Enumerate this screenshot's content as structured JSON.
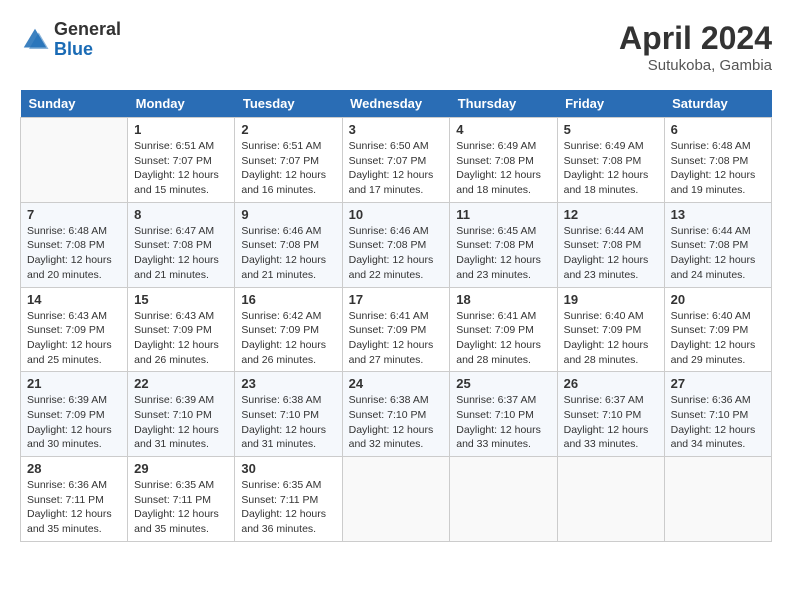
{
  "logo": {
    "general": "General",
    "blue": "Blue"
  },
  "title": "April 2024",
  "subtitle": "Sutukoba, Gambia",
  "days_of_week": [
    "Sunday",
    "Monday",
    "Tuesday",
    "Wednesday",
    "Thursday",
    "Friday",
    "Saturday"
  ],
  "weeks": [
    [
      {
        "num": "",
        "empty": true
      },
      {
        "num": "1",
        "sunrise": "Sunrise: 6:51 AM",
        "sunset": "Sunset: 7:07 PM",
        "daylight": "Daylight: 12 hours and 15 minutes."
      },
      {
        "num": "2",
        "sunrise": "Sunrise: 6:51 AM",
        "sunset": "Sunset: 7:07 PM",
        "daylight": "Daylight: 12 hours and 16 minutes."
      },
      {
        "num": "3",
        "sunrise": "Sunrise: 6:50 AM",
        "sunset": "Sunset: 7:07 PM",
        "daylight": "Daylight: 12 hours and 17 minutes."
      },
      {
        "num": "4",
        "sunrise": "Sunrise: 6:49 AM",
        "sunset": "Sunset: 7:08 PM",
        "daylight": "Daylight: 12 hours and 18 minutes."
      },
      {
        "num": "5",
        "sunrise": "Sunrise: 6:49 AM",
        "sunset": "Sunset: 7:08 PM",
        "daylight": "Daylight: 12 hours and 18 minutes."
      },
      {
        "num": "6",
        "sunrise": "Sunrise: 6:48 AM",
        "sunset": "Sunset: 7:08 PM",
        "daylight": "Daylight: 12 hours and 19 minutes."
      }
    ],
    [
      {
        "num": "7",
        "sunrise": "Sunrise: 6:48 AM",
        "sunset": "Sunset: 7:08 PM",
        "daylight": "Daylight: 12 hours and 20 minutes."
      },
      {
        "num": "8",
        "sunrise": "Sunrise: 6:47 AM",
        "sunset": "Sunset: 7:08 PM",
        "daylight": "Daylight: 12 hours and 21 minutes."
      },
      {
        "num": "9",
        "sunrise": "Sunrise: 6:46 AM",
        "sunset": "Sunset: 7:08 PM",
        "daylight": "Daylight: 12 hours and 21 minutes."
      },
      {
        "num": "10",
        "sunrise": "Sunrise: 6:46 AM",
        "sunset": "Sunset: 7:08 PM",
        "daylight": "Daylight: 12 hours and 22 minutes."
      },
      {
        "num": "11",
        "sunrise": "Sunrise: 6:45 AM",
        "sunset": "Sunset: 7:08 PM",
        "daylight": "Daylight: 12 hours and 23 minutes."
      },
      {
        "num": "12",
        "sunrise": "Sunrise: 6:44 AM",
        "sunset": "Sunset: 7:08 PM",
        "daylight": "Daylight: 12 hours and 23 minutes."
      },
      {
        "num": "13",
        "sunrise": "Sunrise: 6:44 AM",
        "sunset": "Sunset: 7:08 PM",
        "daylight": "Daylight: 12 hours and 24 minutes."
      }
    ],
    [
      {
        "num": "14",
        "sunrise": "Sunrise: 6:43 AM",
        "sunset": "Sunset: 7:09 PM",
        "daylight": "Daylight: 12 hours and 25 minutes."
      },
      {
        "num": "15",
        "sunrise": "Sunrise: 6:43 AM",
        "sunset": "Sunset: 7:09 PM",
        "daylight": "Daylight: 12 hours and 26 minutes."
      },
      {
        "num": "16",
        "sunrise": "Sunrise: 6:42 AM",
        "sunset": "Sunset: 7:09 PM",
        "daylight": "Daylight: 12 hours and 26 minutes."
      },
      {
        "num": "17",
        "sunrise": "Sunrise: 6:41 AM",
        "sunset": "Sunset: 7:09 PM",
        "daylight": "Daylight: 12 hours and 27 minutes."
      },
      {
        "num": "18",
        "sunrise": "Sunrise: 6:41 AM",
        "sunset": "Sunset: 7:09 PM",
        "daylight": "Daylight: 12 hours and 28 minutes."
      },
      {
        "num": "19",
        "sunrise": "Sunrise: 6:40 AM",
        "sunset": "Sunset: 7:09 PM",
        "daylight": "Daylight: 12 hours and 28 minutes."
      },
      {
        "num": "20",
        "sunrise": "Sunrise: 6:40 AM",
        "sunset": "Sunset: 7:09 PM",
        "daylight": "Daylight: 12 hours and 29 minutes."
      }
    ],
    [
      {
        "num": "21",
        "sunrise": "Sunrise: 6:39 AM",
        "sunset": "Sunset: 7:09 PM",
        "daylight": "Daylight: 12 hours and 30 minutes."
      },
      {
        "num": "22",
        "sunrise": "Sunrise: 6:39 AM",
        "sunset": "Sunset: 7:10 PM",
        "daylight": "Daylight: 12 hours and 31 minutes."
      },
      {
        "num": "23",
        "sunrise": "Sunrise: 6:38 AM",
        "sunset": "Sunset: 7:10 PM",
        "daylight": "Daylight: 12 hours and 31 minutes."
      },
      {
        "num": "24",
        "sunrise": "Sunrise: 6:38 AM",
        "sunset": "Sunset: 7:10 PM",
        "daylight": "Daylight: 12 hours and 32 minutes."
      },
      {
        "num": "25",
        "sunrise": "Sunrise: 6:37 AM",
        "sunset": "Sunset: 7:10 PM",
        "daylight": "Daylight: 12 hours and 33 minutes."
      },
      {
        "num": "26",
        "sunrise": "Sunrise: 6:37 AM",
        "sunset": "Sunset: 7:10 PM",
        "daylight": "Daylight: 12 hours and 33 minutes."
      },
      {
        "num": "27",
        "sunrise": "Sunrise: 6:36 AM",
        "sunset": "Sunset: 7:10 PM",
        "daylight": "Daylight: 12 hours and 34 minutes."
      }
    ],
    [
      {
        "num": "28",
        "sunrise": "Sunrise: 6:36 AM",
        "sunset": "Sunset: 7:11 PM",
        "daylight": "Daylight: 12 hours and 35 minutes."
      },
      {
        "num": "29",
        "sunrise": "Sunrise: 6:35 AM",
        "sunset": "Sunset: 7:11 PM",
        "daylight": "Daylight: 12 hours and 35 minutes."
      },
      {
        "num": "30",
        "sunrise": "Sunrise: 6:35 AM",
        "sunset": "Sunset: 7:11 PM",
        "daylight": "Daylight: 12 hours and 36 minutes."
      },
      {
        "num": "",
        "empty": true
      },
      {
        "num": "",
        "empty": true
      },
      {
        "num": "",
        "empty": true
      },
      {
        "num": "",
        "empty": true
      }
    ]
  ]
}
